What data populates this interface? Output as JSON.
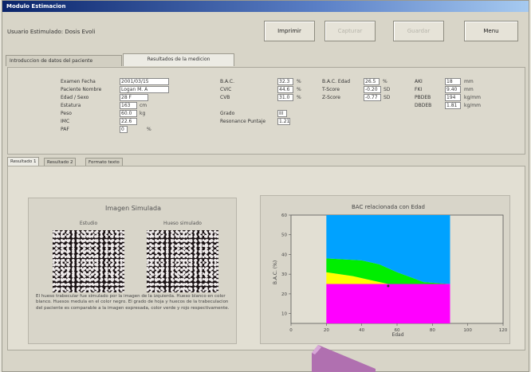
{
  "window": {
    "title": "Modulo Estimacion"
  },
  "header": {
    "user_info": "Usuario Estimulado: Dosis Evoli",
    "buttons": [
      {
        "label": "Imprimir",
        "enabled": true
      },
      {
        "label": "Capturar",
        "enabled": false
      },
      {
        "label": "Guardar",
        "enabled": false
      },
      {
        "label": "Menu",
        "enabled": true
      }
    ]
  },
  "tabs": [
    {
      "label": "Introduccion de datos del paciente",
      "active": false
    },
    {
      "label": "Resultados de la medicion",
      "active": true
    }
  ],
  "patient": {
    "fields": [
      {
        "label": "Examen Fecha",
        "value": "2001/03/15"
      },
      {
        "label": "Paciente Nombre",
        "value": "Logan M. A"
      },
      {
        "label": "Edad / Sexo",
        "value": "28   F",
        "unit": ""
      },
      {
        "label": "Estatura",
        "value": "163",
        "unit": "cm"
      },
      {
        "label": "Peso",
        "value": "60.0",
        "unit": "kg"
      },
      {
        "label": "IMC",
        "value": "22.6",
        "unit": ""
      },
      {
        "label": "PAF",
        "value": "0",
        "unit": "%"
      }
    ]
  },
  "results": {
    "col1": [
      {
        "label": "B.A.C.",
        "value": "32.3",
        "unit": "%"
      },
      {
        "label": "CVIC",
        "value": "44.6",
        "unit": "%"
      },
      {
        "label": "CVB",
        "value": "31.0",
        "unit": "%"
      },
      {
        "label": "Grado",
        "value": "III",
        "unit": ""
      },
      {
        "label": "Resonance Puntaje",
        "value": "1.21",
        "unit": ""
      }
    ],
    "col2": [
      {
        "label": "B.A.C. Edad",
        "value": "26.5",
        "unit": "%"
      },
      {
        "label": "T-Score",
        "value": "-0.20",
        "unit": "SD"
      },
      {
        "label": "Z-Score",
        "value": "-0.77",
        "unit": "SD"
      }
    ],
    "col3": [
      {
        "label": "AKI",
        "value": "18",
        "unit": "mm"
      },
      {
        "label": "FKI",
        "value": "9.40",
        "unit": "mm"
      },
      {
        "label": "PBDEB",
        "value": "194",
        "unit": "kg/mm"
      },
      {
        "label": "DBDEB",
        "value": "1.81",
        "unit": "kg/mm"
      }
    ]
  },
  "subtabs": [
    {
      "label": "Resultado 1",
      "active": true
    },
    {
      "label": "Resultado 2",
      "active": false
    },
    {
      "label": "Formato texto",
      "active": false
    }
  ],
  "image_panel": {
    "title": "Imagen Simulada",
    "left_label": "Estudio",
    "right_label": "Hueso simulado",
    "description": "El hueso trabecular fue simulado por la imagen de la izquierda. Hueso blanco en color blanco. Huesos medula en el color negro. El grado de hoja y huecos de la trabeculacion del paciente es comparable a la imagen expresada, color verde y rojo respectivamente."
  },
  "chart_data": {
    "type": "area",
    "title": "BAC relacionada con Edad",
    "xlabel": "Edad",
    "ylabel": "B.A.C. (%)",
    "xlim": [
      0,
      120
    ],
    "ylim": [
      5,
      60
    ],
    "xticks": [
      0,
      20,
      40,
      60,
      80,
      100,
      120
    ],
    "yticks": [
      10,
      20,
      30,
      40,
      50,
      60
    ],
    "x_range": [
      20,
      90
    ],
    "bands": [
      {
        "color": "#ff00ff",
        "lower": [
          {
            "x": 20,
            "y": 5
          },
          {
            "x": 90,
            "y": 5
          }
        ],
        "upper": [
          {
            "x": 20,
            "y": 25
          },
          {
            "x": 90,
            "y": 25
          }
        ]
      },
      {
        "color": "#ffff00",
        "lower": [
          {
            "x": 20,
            "y": 25
          },
          {
            "x": 90,
            "y": 25
          }
        ],
        "upper": [
          {
            "x": 20,
            "y": 31
          },
          {
            "x": 35,
            "y": 29
          },
          {
            "x": 45,
            "y": 27
          },
          {
            "x": 55,
            "y": 25
          },
          {
            "x": 90,
            "y": 25
          }
        ]
      },
      {
        "color": "#00ee00",
        "lower": [
          {
            "x": 20,
            "y": 31
          },
          {
            "x": 35,
            "y": 29
          },
          {
            "x": 45,
            "y": 27
          },
          {
            "x": 55,
            "y": 25
          },
          {
            "x": 90,
            "y": 25
          }
        ],
        "upper": [
          {
            "x": 20,
            "y": 38
          },
          {
            "x": 40,
            "y": 37
          },
          {
            "x": 50,
            "y": 35
          },
          {
            "x": 60,
            "y": 31
          },
          {
            "x": 75,
            "y": 26
          },
          {
            "x": 90,
            "y": 25
          }
        ]
      },
      {
        "color": "#00a2ff",
        "lower": [
          {
            "x": 20,
            "y": 38
          },
          {
            "x": 40,
            "y": 37
          },
          {
            "x": 50,
            "y": 35
          },
          {
            "x": 60,
            "y": 31
          },
          {
            "x": 75,
            "y": 26
          },
          {
            "x": 90,
            "y": 25
          }
        ],
        "upper": [
          {
            "x": 20,
            "y": 60
          },
          {
            "x": 90,
            "y": 60
          }
        ]
      }
    ],
    "marker": {
      "x": 55,
      "y": 24
    }
  }
}
